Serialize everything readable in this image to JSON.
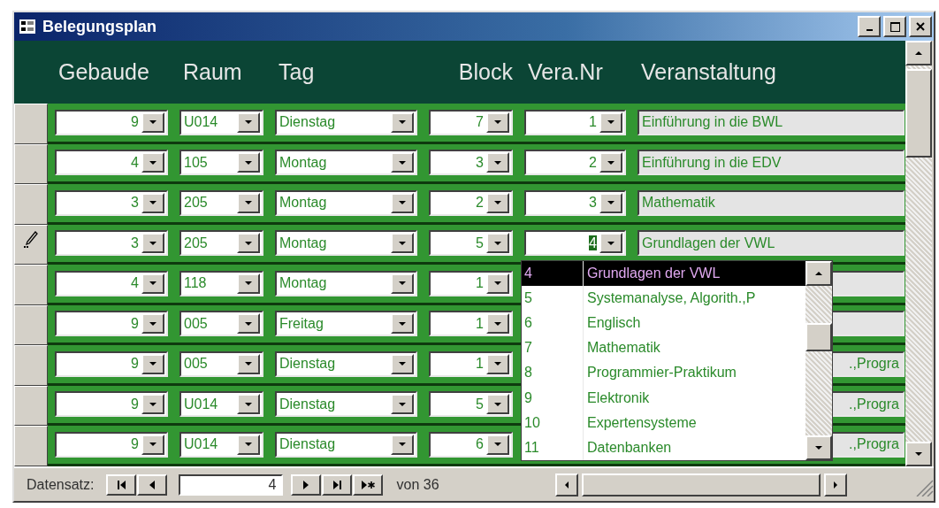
{
  "window": {
    "title": "Belegungsplan"
  },
  "columns": [
    "Gebaude",
    "Raum",
    "Tag",
    "Block",
    "Vera.Nr",
    "Veranstaltung"
  ],
  "rows": [
    {
      "gebaude": "9",
      "raum": "U014",
      "tag": "Dienstag",
      "block": "7",
      "vera_nr": "1",
      "vera_nr_highlighted": false,
      "veranstaltung": "Einführung in die BWL",
      "covered": false,
      "editing": false
    },
    {
      "gebaude": "4",
      "raum": "105",
      "tag": "Montag",
      "block": "3",
      "vera_nr": "2",
      "vera_nr_highlighted": false,
      "veranstaltung": "Einführung in die EDV",
      "covered": false,
      "editing": false
    },
    {
      "gebaude": "3",
      "raum": "205",
      "tag": "Montag",
      "block": "2",
      "vera_nr": "3",
      "vera_nr_highlighted": false,
      "veranstaltung": "Mathematik",
      "covered": false,
      "editing": false
    },
    {
      "gebaude": "3",
      "raum": "205",
      "tag": "Montag",
      "block": "5",
      "vera_nr": "4",
      "vera_nr_highlighted": true,
      "veranstaltung": "Grundlagen der VWL",
      "covered": false,
      "editing": true
    },
    {
      "gebaude": "4",
      "raum": "118",
      "tag": "Montag",
      "block": "1",
      "editing": false
    },
    {
      "gebaude": "9",
      "raum": "005",
      "tag": "Freitag",
      "block": "1",
      "editing": false
    },
    {
      "gebaude": "9",
      "raum": "005",
      "tag": "Dienstag",
      "block": "1",
      "veranstaltung": ".,Progra",
      "covered": true,
      "editing": false
    },
    {
      "gebaude": "9",
      "raum": "U014",
      "tag": "Dienstag",
      "block": "5",
      "veranstaltung": ".,Progra",
      "covered": true,
      "editing": false
    },
    {
      "gebaude": "9",
      "raum": "U014",
      "tag": "Dienstag",
      "block": "6",
      "veranstaltung": ".,Progra",
      "covered": true,
      "editing": false
    }
  ],
  "dropdown": {
    "items": [
      {
        "number": "4",
        "title": "Grundlagen der VWL",
        "selected": true
      },
      {
        "number": "5",
        "title": "Systemanalyse, Algorith.,P",
        "selected": false
      },
      {
        "number": "6",
        "title": "Englisch",
        "selected": false
      },
      {
        "number": "7",
        "title": "Mathematik",
        "selected": false
      },
      {
        "number": "8",
        "title": "Programmier-Praktikum",
        "selected": false
      },
      {
        "number": "9",
        "title": "Elektronik",
        "selected": false
      },
      {
        "number": "10",
        "title": "Expertensysteme",
        "selected": false
      },
      {
        "number": "11",
        "title": "Datenbanken",
        "selected": false
      }
    ]
  },
  "navigation": {
    "label": "Datensatz:",
    "current": "4",
    "total_label": "von 36"
  }
}
